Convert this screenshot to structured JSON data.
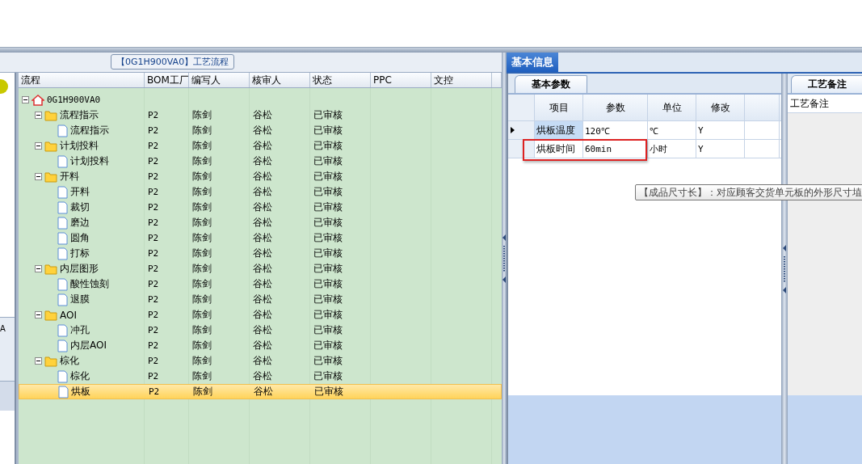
{
  "panel_title": "【0G1H900VA0】工艺流程",
  "side_stub": {
    "text": "A"
  },
  "tree": {
    "columns": [
      "流程",
      "BOM工厂",
      "编写人",
      "核审人",
      "状态",
      "PPC",
      "文控"
    ],
    "nodes": [
      {
        "label": "0G1H900VA0",
        "kind": "root",
        "expanded": true,
        "selected": false,
        "children": [
          {
            "label": "流程指示",
            "kind": "folder",
            "expanded": true,
            "selected": false,
            "cells": [
              "P2",
              "陈剑",
              "谷松",
              "已审核"
            ],
            "children": [
              {
                "label": "流程指示",
                "kind": "doc",
                "selected": false,
                "cells": [
                  "P2",
                  "陈剑",
                  "谷松",
                  "已审核"
                ]
              }
            ]
          },
          {
            "label": "计划投料",
            "kind": "folder",
            "expanded": true,
            "selected": false,
            "cells": [
              "P2",
              "陈剑",
              "谷松",
              "已审核"
            ],
            "children": [
              {
                "label": "计划投料",
                "kind": "doc",
                "selected": false,
                "cells": [
                  "P2",
                  "陈剑",
                  "谷松",
                  "已审核"
                ]
              }
            ]
          },
          {
            "label": "开料",
            "kind": "folder",
            "expanded": true,
            "selected": false,
            "cells": [
              "P2",
              "陈剑",
              "谷松",
              "已审核"
            ],
            "children": [
              {
                "label": "开料",
                "kind": "doc",
                "selected": false,
                "cells": [
                  "P2",
                  "陈剑",
                  "谷松",
                  "已审核"
                ]
              },
              {
                "label": "裁切",
                "kind": "doc",
                "selected": false,
                "cells": [
                  "P2",
                  "陈剑",
                  "谷松",
                  "已审核"
                ]
              },
              {
                "label": "磨边",
                "kind": "doc",
                "selected": false,
                "cells": [
                  "P2",
                  "陈剑",
                  "谷松",
                  "已审核"
                ]
              },
              {
                "label": "圆角",
                "kind": "doc",
                "selected": false,
                "cells": [
                  "P2",
                  "陈剑",
                  "谷松",
                  "已审核"
                ]
              },
              {
                "label": "打标",
                "kind": "doc",
                "selected": false,
                "cells": [
                  "P2",
                  "陈剑",
                  "谷松",
                  "已审核"
                ]
              }
            ]
          },
          {
            "label": "内层图形",
            "kind": "folder",
            "expanded": true,
            "selected": false,
            "cells": [
              "P2",
              "陈剑",
              "谷松",
              "已审核"
            ],
            "children": [
              {
                "label": "酸性蚀刻",
                "kind": "doc",
                "selected": false,
                "cells": [
                  "P2",
                  "陈剑",
                  "谷松",
                  "已审核"
                ]
              },
              {
                "label": "退膜",
                "kind": "doc",
                "selected": false,
                "cells": [
                  "P2",
                  "陈剑",
                  "谷松",
                  "已审核"
                ]
              }
            ]
          },
          {
            "label": "AOI",
            "kind": "folder",
            "expanded": true,
            "selected": false,
            "cells": [
              "P2",
              "陈剑",
              "谷松",
              "已审核"
            ],
            "children": [
              {
                "label": "冲孔",
                "kind": "doc",
                "selected": false,
                "cells": [
                  "P2",
                  "陈剑",
                  "谷松",
                  "已审核"
                ]
              },
              {
                "label": "内层AOI",
                "kind": "doc",
                "selected": false,
                "cells": [
                  "P2",
                  "陈剑",
                  "谷松",
                  "已审核"
                ]
              }
            ]
          },
          {
            "label": "棕化",
            "kind": "folder",
            "expanded": true,
            "selected": false,
            "cells": [
              "P2",
              "陈剑",
              "谷松",
              "已审核"
            ],
            "children": [
              {
                "label": "棕化",
                "kind": "doc",
                "selected": false,
                "cells": [
                  "P2",
                  "陈剑",
                  "谷松",
                  "已审核"
                ]
              },
              {
                "label": "烘板",
                "kind": "doc",
                "selected": true,
                "cells": [
                  "P2",
                  "陈剑",
                  "谷松",
                  "已审核"
                ]
              }
            ]
          }
        ]
      }
    ]
  },
  "tabs": [
    {
      "label": "基本信息",
      "selected": true
    }
  ],
  "params_panel": {
    "tab": "基本参数",
    "columns": [
      "项目",
      "参数",
      "单位",
      "修改"
    ],
    "rows": [
      {
        "cells": [
          "烘板温度",
          "120℃",
          "℃",
          "Y"
        ],
        "current": true,
        "highlighted": false
      },
      {
        "cells": [
          "烘板时间",
          "60min",
          "小时",
          "Y"
        ],
        "current": false,
        "highlighted": true
      }
    ]
  },
  "tooltip": "【成品尺寸长】：对应顾客交货单元板的外形尺寸埴",
  "notes_panel": {
    "tab": "工艺备注",
    "label": "工艺备注"
  }
}
